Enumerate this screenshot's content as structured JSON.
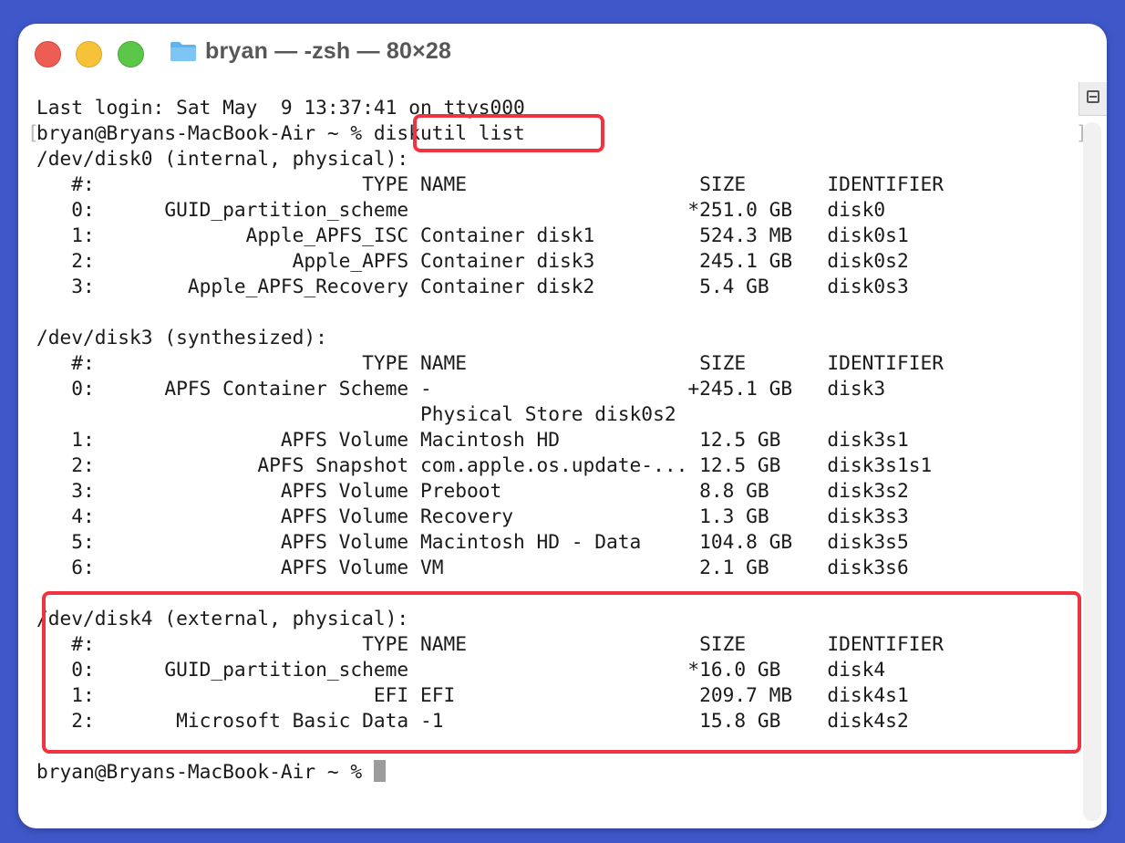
{
  "window": {
    "title": "bryan — -zsh — 80×28",
    "folder_icon": "folder-icon",
    "accent_highlight": "#ef3340"
  },
  "terminal": {
    "lines": [
      "Last login: Sat May  9 13:37:41 on ttys000",
      "bryan@Bryans-MacBook-Air ~ % diskutil list",
      "/dev/disk0 (internal, physical):",
      "   #:                       TYPE NAME                    SIZE       IDENTIFIER",
      "   0:      GUID_partition_scheme                        *251.0 GB   disk0",
      "   1:             Apple_APFS_ISC Container disk1         524.3 MB   disk0s1",
      "   2:                 Apple_APFS Container disk3         245.1 GB   disk0s2",
      "   3:        Apple_APFS_Recovery Container disk2         5.4 GB     disk0s3",
      "",
      "/dev/disk3 (synthesized):",
      "   #:                       TYPE NAME                    SIZE       IDENTIFIER",
      "   0:      APFS Container Scheme -                      +245.1 GB   disk3",
      "                                 Physical Store disk0s2",
      "   1:                APFS Volume Macintosh HD            12.5 GB    disk3s1",
      "   2:              APFS Snapshot com.apple.os.update-... 12.5 GB    disk3s1s1",
      "   3:                APFS Volume Preboot                 8.8 GB     disk3s2",
      "   4:                APFS Volume Recovery                1.3 GB     disk3s3",
      "   5:                APFS Volume Macintosh HD - Data     104.8 GB   disk3s5",
      "   6:                APFS Volume VM                      2.1 GB     disk3s6",
      "",
      "/dev/disk4 (external, physical):",
      "   #:                       TYPE NAME                    SIZE       IDENTIFIER",
      "   0:      GUID_partition_scheme                        *16.0 GB    disk4",
      "   1:                        EFI EFI                     209.7 MB   disk4s1",
      "   2:       Microsoft Basic Data -1                      15.8 GB    disk4s2",
      "",
      "bryan@Bryans-MacBook-Air ~ % "
    ]
  }
}
